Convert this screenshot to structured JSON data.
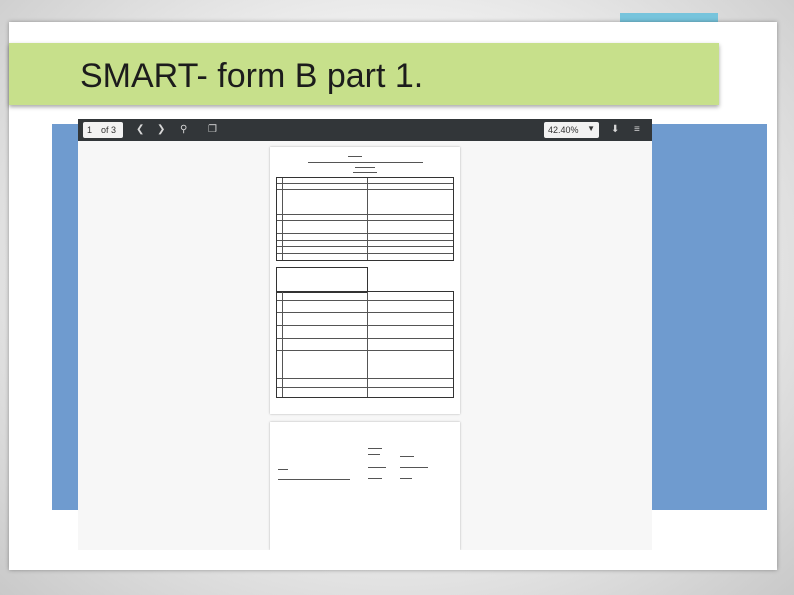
{
  "slide": {
    "title": "SMART- form B part 1."
  },
  "viewer": {
    "current_page": "1",
    "page_count": "of 3",
    "zoom": "42.40%",
    "icons": [
      "chevron-left-icon",
      "chevron-right-icon",
      "search-icon",
      "copy-icon",
      "download-icon",
      "menu-icon"
    ]
  },
  "colors": {
    "title_bar": "#c7e08b",
    "blue_panel": "#6f9bcf",
    "teal_accent": "#77c4dc",
    "toolbar": "#323639"
  }
}
